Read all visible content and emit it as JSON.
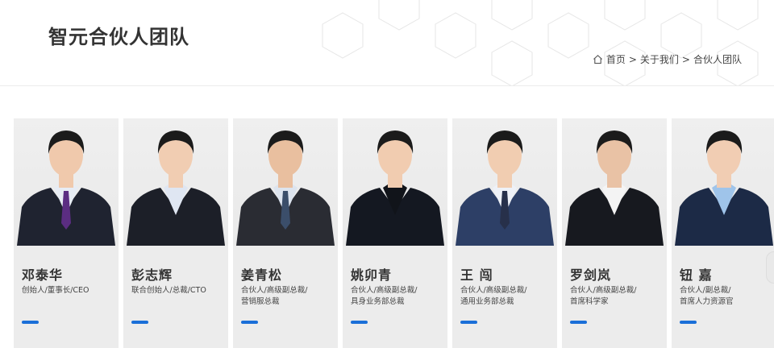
{
  "page": {
    "title": "智元合伙人团队",
    "breadcrumb": {
      "home_icon": "home-icon",
      "home": "首页",
      "sep1": ">",
      "about": "关于我们",
      "sep2": ">",
      "current": "合伙人团队"
    }
  },
  "colors": {
    "accent": "#1a6fd8",
    "card_bg": "#ececec"
  },
  "partners": [
    {
      "name": "邓泰华",
      "role_line1": "创始人/董事长/CEO",
      "role_line2": "",
      "tie": "#5b2d82",
      "suit": "#1f2330",
      "shirt": "#e7ecf4",
      "skin": "#f0c9ac"
    },
    {
      "name": "彭志辉",
      "role_line1": "联合创始人/总裁/CTO",
      "role_line2": "",
      "tie": "",
      "suit": "#1c1f28",
      "shirt": "#dfe6f2",
      "skin": "#f1cdb2"
    },
    {
      "name": "姜青松",
      "role_line1": "合伙人/高级副总裁/",
      "role_line2": "营销服总裁",
      "tie": "#3b4e6a",
      "suit": "#2a2c33",
      "shirt": "#dde4ee",
      "skin": "#e9bf9f"
    },
    {
      "name": "姚卯青",
      "role_line1": "合伙人/高级副总裁/",
      "role_line2": "具身业务部总裁",
      "tie": "",
      "suit": "#141821",
      "shirt": "#11141a",
      "skin": "#f1ccb0"
    },
    {
      "name": "王 闯",
      "role_line1": "合伙人/高级副总裁/",
      "role_line2": "通用业务部总裁",
      "tie": "#27304a",
      "suit": "#2d3f66",
      "shirt": "#eef1f7",
      "skin": "#f1cdb1"
    },
    {
      "name": "罗剑岚",
      "role_line1": "合伙人/高级副总裁/",
      "role_line2": "首席科学家",
      "tie": "",
      "suit": "#17191f",
      "shirt": "#f4f4f4",
      "skin": "#e9c2a5"
    },
    {
      "name": "钮 嘉",
      "role_line1": "合伙人/副总裁/",
      "role_line2": "首席人力资源官",
      "tie": "",
      "suit": "#1c2a46",
      "shirt": "#9fc4ea",
      "skin": "#f1cdb3"
    }
  ]
}
